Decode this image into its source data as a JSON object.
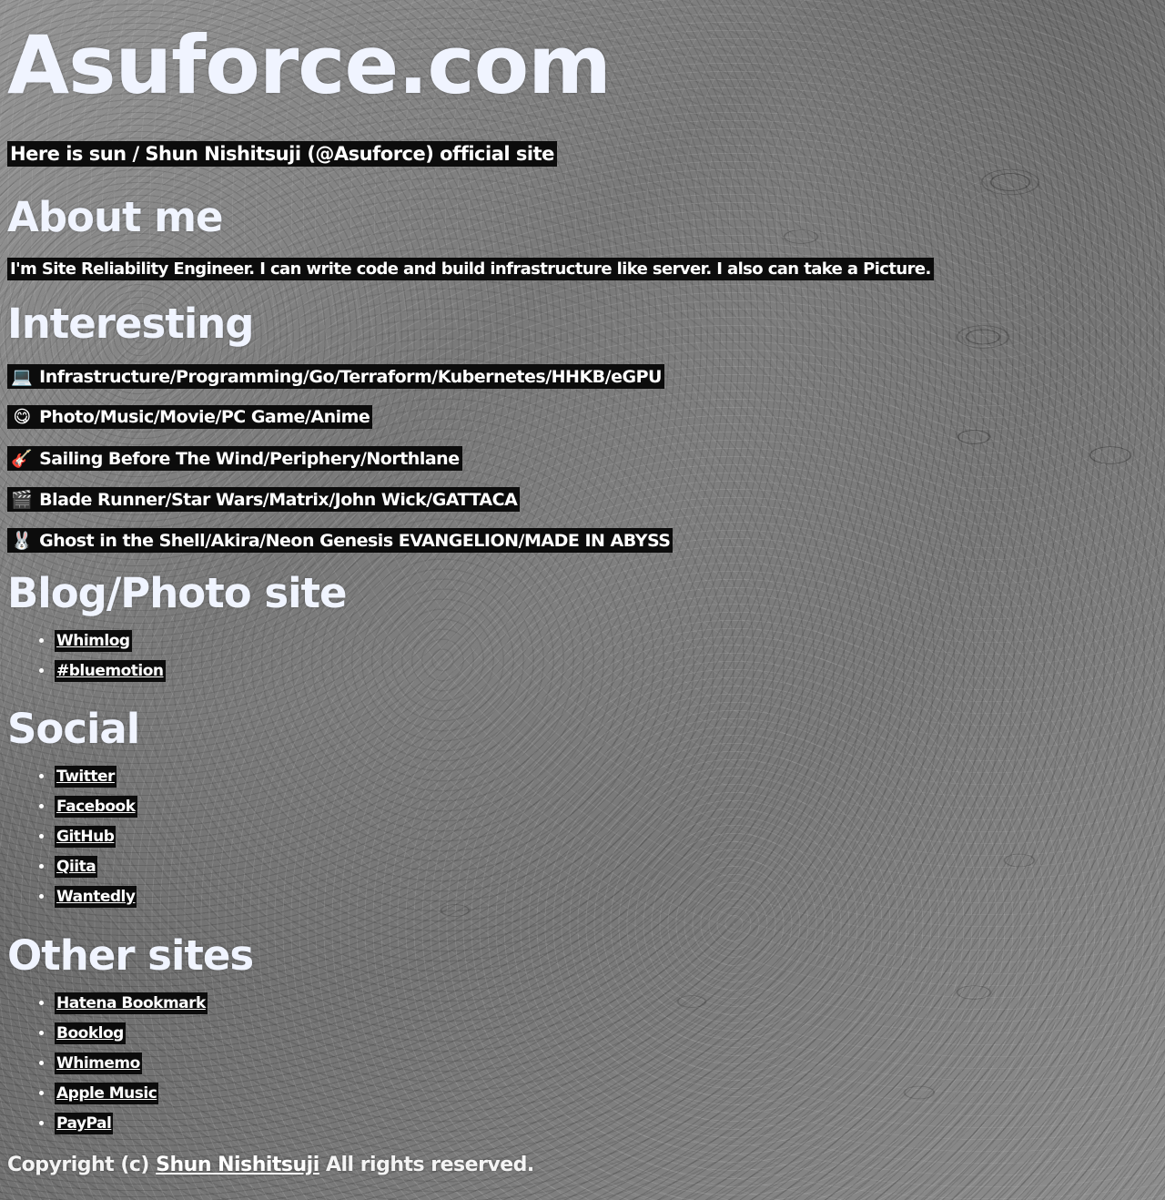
{
  "site": {
    "title": "Asuforce.com",
    "tagline": "Here is sun / Shun Nishitsuji (@Asuforce) official site"
  },
  "about": {
    "heading": "About me",
    "text": "I'm Site Reliability Engineer. I can write code and build infrastructure like server. I also can take a Picture."
  },
  "interesting": {
    "heading": "Interesting",
    "items": [
      {
        "emoji": "💻",
        "text": "Infrastructure/Programming/Go/Terraform/Kubernetes/HHKB/eGPU"
      },
      {
        "emoji": "😋",
        "text": "Photo/Music/Movie/PC Game/Anime"
      },
      {
        "emoji": "🎸",
        "text": "Sailing Before The Wind/Periphery/Northlane"
      },
      {
        "emoji": "🎬",
        "text": "Blade Runner/Star Wars/Matrix/John Wick/GATTACA"
      },
      {
        "emoji": "🐰",
        "text": "Ghost in the Shell/Akira/Neon Genesis EVANGELION/MADE IN ABYSS"
      }
    ]
  },
  "blog": {
    "heading": "Blog/Photo site",
    "links": [
      "Whimlog",
      "#bluemotion"
    ]
  },
  "social": {
    "heading": "Social",
    "links": [
      "Twitter",
      "Facebook",
      "GitHub",
      "Qiita",
      "Wantedly"
    ]
  },
  "other": {
    "heading": "Other sites",
    "links": [
      "Hatena Bookmark",
      "Booklog",
      "Whimemo",
      "Apple Music",
      "PayPal"
    ]
  },
  "footer": {
    "prefix": "Copyright (c)",
    "author": "Shun Nishitsuji",
    "suffix": "All rights reserved."
  }
}
